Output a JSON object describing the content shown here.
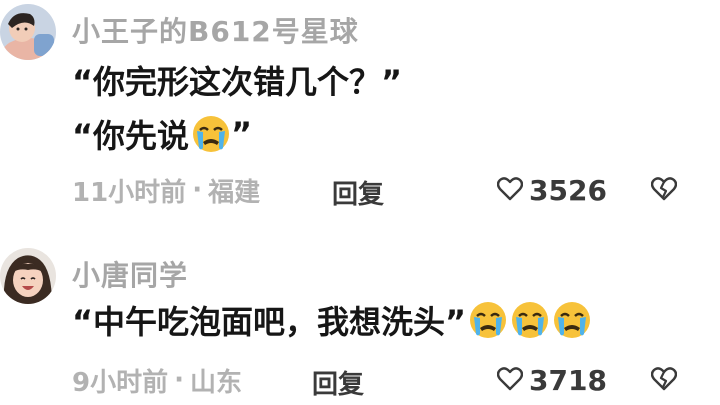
{
  "comments": [
    {
      "username": "小王子的B612号星球",
      "lines": [
        "“你完形这次错几个？”",
        "“你先说"
      ],
      "line2_suffix": "”",
      "line2_emojis": [
        "crying-emoji"
      ],
      "time": "11小时前",
      "separator": "·",
      "location": "福建",
      "reply_label": "回复",
      "likes": "3526",
      "icons": {
        "like": "heart-outline-icon",
        "dislike": "broken-heart-icon"
      }
    },
    {
      "username": "小唐同学",
      "lines": [
        "“中午吃泡面吧，我想洗头”"
      ],
      "line1_emojis": [
        "crying-emoji",
        "crying-emoji",
        "crying-emoji"
      ],
      "time": "9小时前",
      "separator": "·",
      "location": "山东",
      "reply_label": "回复",
      "likes": "3718",
      "icons": {
        "like": "heart-outline-icon",
        "dislike": "broken-heart-icon"
      }
    }
  ],
  "colors": {
    "username": "#a6a6a6",
    "text": "#161616",
    "meta": "#b2b2b2",
    "action": "#3a3a3a",
    "emoji_face": "#f7c23a",
    "emoji_tears": "#4fb3ea"
  }
}
